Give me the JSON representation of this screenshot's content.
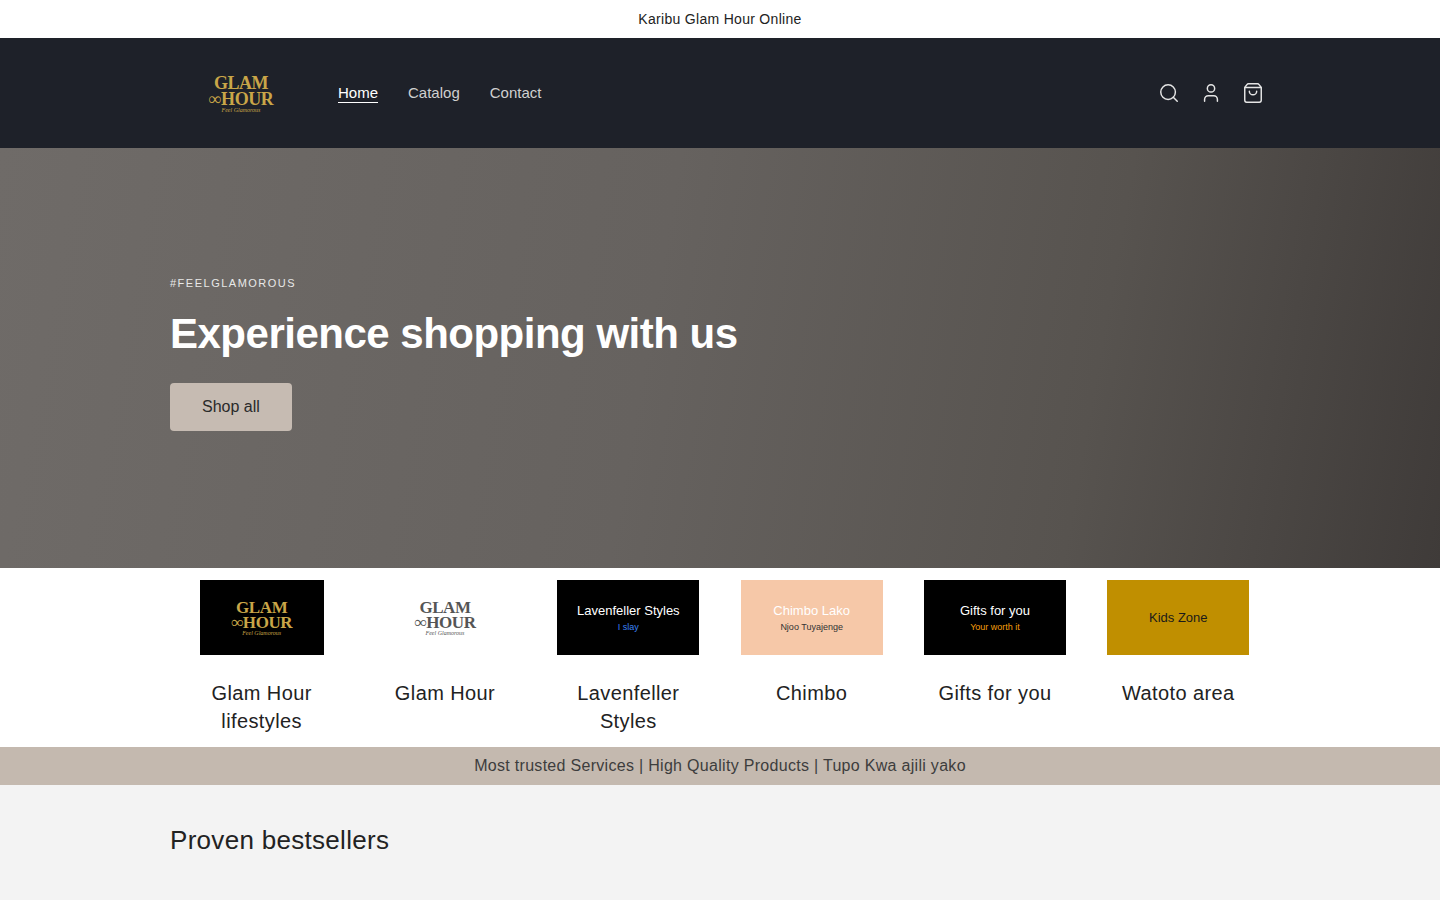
{
  "announcement": "Karibu Glam Hour Online",
  "header": {
    "logo": {
      "top": "GLAM",
      "bottom": "∞HOUR",
      "tagline": "Feel Glamorous"
    },
    "nav": [
      {
        "label": "Home",
        "selected": true
      },
      {
        "label": "Catalog",
        "selected": false
      },
      {
        "label": "Contact",
        "selected": false
      }
    ]
  },
  "hero": {
    "eyebrow": "#FEELGLAMOROUS",
    "title": "Experience shopping with us",
    "button": "Shop all"
  },
  "collections": [
    {
      "label": "Glam Hour lifestyles",
      "kind": "logo",
      "color": "#000000",
      "ink": "#c9a648",
      "sub_ink": "#c9a648",
      "title": "",
      "subtitle": ""
    },
    {
      "label": "Glam Hour",
      "kind": "logo",
      "color": "#ffffff",
      "ink": "#555555",
      "sub_ink": "#555555",
      "title": "",
      "subtitle": ""
    },
    {
      "label": "Lavenfeller Styles",
      "kind": "text",
      "color": "#000000",
      "ink": "#ffffff",
      "sub_ink": "#3b82f6",
      "title": "Lavenfeller Styles",
      "subtitle": "I slay"
    },
    {
      "label": "Chimbo",
      "kind": "text",
      "color": "#f6c8a8",
      "ink": "#ffffff",
      "sub_ink": "#333333",
      "title": "Chimbo Lako",
      "subtitle": "Njoo Tuyajenge"
    },
    {
      "label": "Gifts for you",
      "kind": "text",
      "color": "#000000",
      "ink": "#ffffff",
      "sub_ink": "#f59e0b",
      "title": "Gifts for you",
      "subtitle": "Your worth it"
    },
    {
      "label": "Watoto area",
      "kind": "text",
      "color": "#c08f00",
      "ink": "#1a1a1a",
      "sub_ink": "#1a1a1a",
      "title": "Kids Zone",
      "subtitle": ""
    }
  ],
  "strip": "Most trusted Services | High Quality Products | Tupo Kwa ajili yako",
  "section": {
    "title": "Proven bestsellers"
  }
}
